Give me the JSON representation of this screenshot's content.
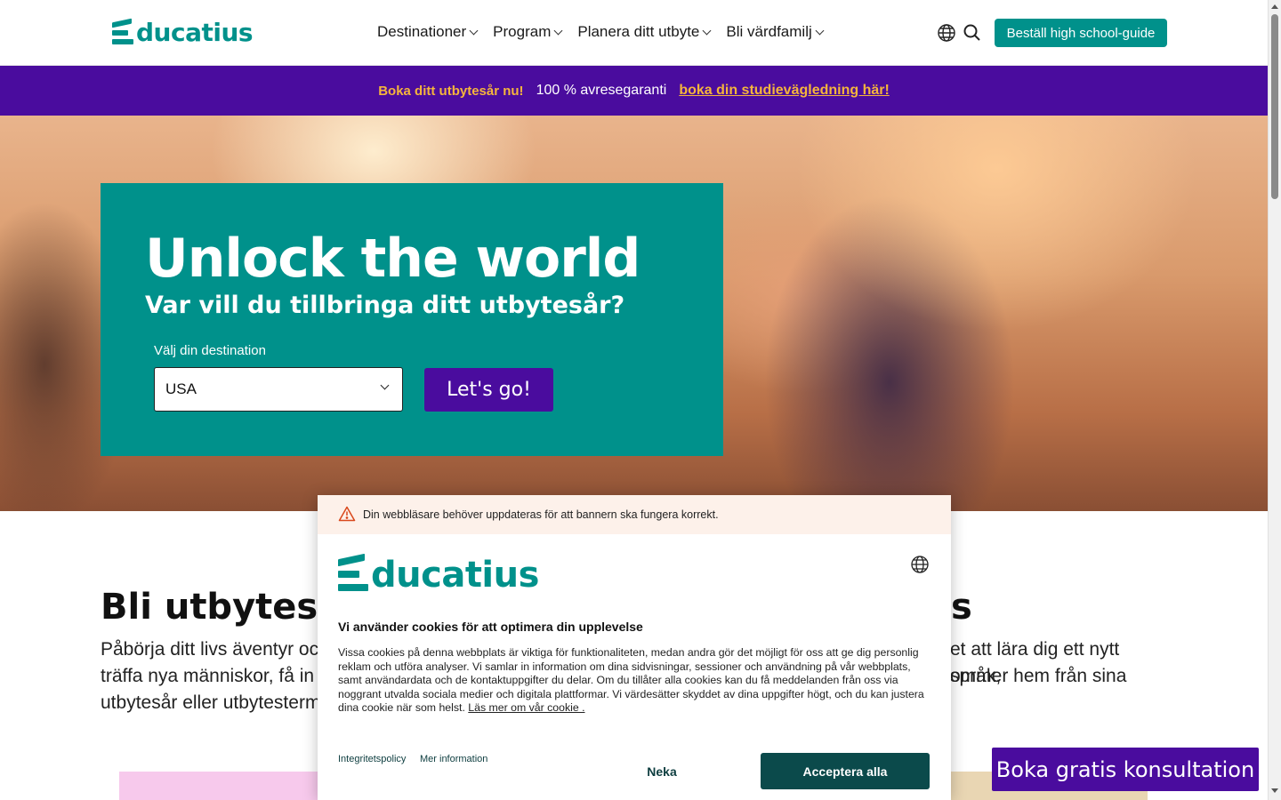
{
  "brand": {
    "name": "Educatius",
    "logo_text": "ducatius",
    "color": "#00918b"
  },
  "header": {
    "nav": [
      {
        "label": "Destinationer"
      },
      {
        "label": "Program"
      },
      {
        "label": "Planera ditt utbyte"
      },
      {
        "label": "Bli värdfamilj"
      }
    ],
    "icons": [
      "globe-icon",
      "search-icon"
    ],
    "cta_label": "Beställ high school-guide"
  },
  "promo": {
    "bold_text": "Boka ditt utbytesår nu!",
    "text": "100 % avresegaranti",
    "link_text": "boka din studievägledning här!",
    "background": "#4a0c9e",
    "accent": "#f5b53c"
  },
  "hero": {
    "title": "Unlock the world",
    "subtitle": "Var vill du tillbringa ditt utbytesår?",
    "select_label": "Välj din destination",
    "select_value": "USA",
    "button_label": "Let's go!"
  },
  "content": {
    "title_left": "Bli utbytesstu",
    "title_right": "s",
    "body_lines_left": [
      "Påbörja ditt livs äventyr och",
      "träffa nya människor, få in",
      "utbytesår eller utbytestermi"
    ],
    "body_lines_right": [
      "et att lära dig ett nytt språk,",
      "ommer hem från sina",
      ""
    ]
  },
  "float_cta": {
    "label": "Boka gratis konsultation"
  },
  "cookie": {
    "warning": "Din webbläsare behöver uppdateras för att bannern ska fungera korrekt.",
    "heading": "Vi använder cookies för att optimera din upplevelse",
    "body": "Vissa cookies på denna webbplats är viktiga för funktionaliteten, medan andra gör det möjligt för oss att ge dig personlig reklam och utföra analyser. Vi samlar in information om dina sidvisningar, sessioner och användning på vår webbplats, samt användardata och de kontaktuppgifter du delar. Om du tillåter alla cookies kan du få meddelanden från oss via noggrant utvalda sociala medier och digitala plattformar. Vi värdesätter skyddet av dina uppgifter högt, och du kan justera dina cookie när som helst.",
    "read_more": "Läs mer om vår cookie .",
    "privacy_link": "Integritetspolicy",
    "more_info_link": "Mer information",
    "decline_label": "Neka",
    "accept_label": "Acceptera alla"
  }
}
